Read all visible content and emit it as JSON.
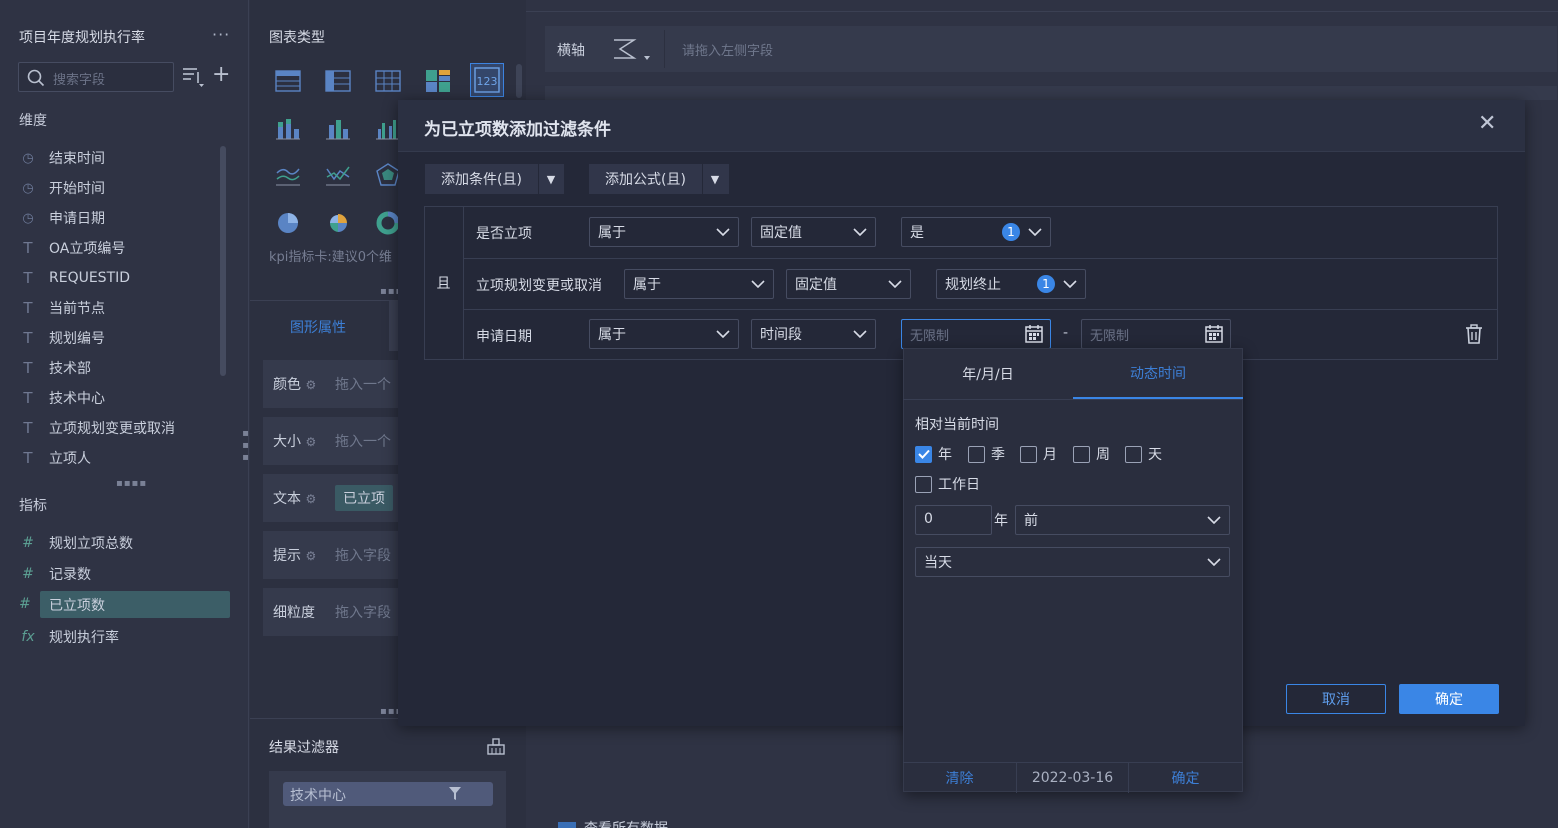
{
  "left_panel": {
    "title": "项目年度规划执行率",
    "more": "···",
    "search_placeholder": "搜索字段",
    "dimensions_label": "维度",
    "dimensions": [
      {
        "label": "结束时间",
        "icon": "clock-icon"
      },
      {
        "label": "开始时间",
        "icon": "clock-icon"
      },
      {
        "label": "申请日期",
        "icon": "clock-icon"
      },
      {
        "label": "OA立项编号",
        "icon": "text-type-icon"
      },
      {
        "label": "REQUESTID",
        "icon": "text-type-icon"
      },
      {
        "label": "当前节点",
        "icon": "text-type-icon"
      },
      {
        "label": "规划编号",
        "icon": "text-type-icon"
      },
      {
        "label": "技术部",
        "icon": "text-type-icon"
      },
      {
        "label": "技术中心",
        "icon": "text-type-icon"
      },
      {
        "label": "立项规划变更或取消",
        "icon": "text-type-icon"
      },
      {
        "label": "立项人",
        "icon": "text-type-icon"
      }
    ],
    "measures_label": "指标",
    "measures": [
      {
        "label": "规划立项总数",
        "icon": "hash-icon"
      },
      {
        "label": "记录数",
        "icon": "hash-icon"
      },
      {
        "label": "已立项数",
        "icon": "hash-icon",
        "selected": true
      },
      {
        "label": "规划执行率",
        "icon": "formula-icon"
      }
    ]
  },
  "chart_panel": {
    "title": "图表类型",
    "kpi_hint": "kpi指标卡:建议0个维",
    "tab_graph": "图形属性",
    "props": [
      {
        "label": "颜色",
        "value": "拖入一个"
      },
      {
        "label": "大小",
        "value": "拖入一个"
      },
      {
        "label": "文本",
        "value": "已立项"
      },
      {
        "label": "提示",
        "value": "拖入字段"
      },
      {
        "label": "细粒度",
        "value": "拖入字段"
      }
    ],
    "result_filter_title": "结果过滤器",
    "result_filter_chip": "技术中心"
  },
  "axis": {
    "label": "横轴",
    "placeholder": "请拖入左侧字段"
  },
  "dialog": {
    "title": "为已立项数添加过滤条件",
    "add_condition": "添加条件(且)",
    "add_formula": "添加公式(且)",
    "and_label": "且",
    "conditions": [
      {
        "field": "是否立项",
        "op": "属于",
        "mode": "固定值",
        "value": "是",
        "count": "1"
      },
      {
        "field": "立项规划变更或取消",
        "op": "属于",
        "mode": "固定值",
        "value": "规划终止",
        "count": "1"
      },
      {
        "field": "申请日期",
        "op": "属于",
        "mode": "时间段",
        "start_placeholder": "无限制",
        "end_placeholder": "无限制",
        "dash": "-"
      }
    ],
    "cancel": "取消",
    "ok": "确定"
  },
  "date_popover": {
    "tab_ymd": "年/月/日",
    "tab_dynamic": "动态时间",
    "relative_label": "相对当前时间",
    "units": [
      {
        "label": "年",
        "checked": true
      },
      {
        "label": "季",
        "checked": false
      },
      {
        "label": "月",
        "checked": false
      },
      {
        "label": "周",
        "checked": false
      },
      {
        "label": "天",
        "checked": false
      }
    ],
    "workday": {
      "label": "工作日",
      "checked": false
    },
    "offset_value": "0",
    "offset_unit": "年",
    "direction": "前",
    "anchor": "当天",
    "footer_clear": "清除",
    "footer_date": "2022-03-16",
    "footer_ok": "确定"
  },
  "bottom_label": "查看所有数据",
  "colors": {
    "accent": "#3a86e6",
    "selected_field": "#3c5e67",
    "dialog_bg": "#242838"
  }
}
